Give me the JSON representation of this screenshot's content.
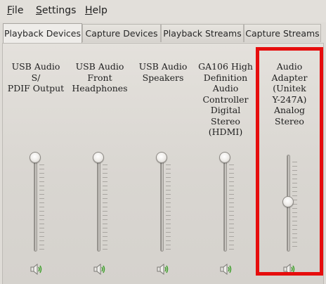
{
  "menu": {
    "items": [
      {
        "label": "File",
        "mnemonic": "F",
        "rest": "ile"
      },
      {
        "label": "Settings",
        "mnemonic": "S",
        "rest": "ettings"
      },
      {
        "label": "Help",
        "mnemonic": "H",
        "rest": "elp"
      }
    ]
  },
  "tabs": [
    {
      "label": "Playback Devices",
      "active": true
    },
    {
      "label": "Capture Devices",
      "active": false
    },
    {
      "label": "Playback Streams",
      "active": false
    },
    {
      "label": "Capture Streams",
      "active": false
    }
  ],
  "devices": [
    {
      "name": "USB Audio S/ PDIF Output",
      "lines": [
        "USB Audio S/",
        "PDIF Output"
      ],
      "volume_fraction": 1.0
    },
    {
      "name": "USB Audio Front Headphones",
      "lines": [
        "USB Audio",
        "Front",
        "Headphones"
      ],
      "volume_fraction": 1.0
    },
    {
      "name": "USB Audio Speakers",
      "lines": [
        "USB Audio",
        "Speakers"
      ],
      "volume_fraction": 1.0
    },
    {
      "name": "GA106 High Definition Audio Controller Digital Stereo (HDMI)",
      "lines": [
        "GA106 High",
        "Definition",
        "Audio",
        "Controller",
        "Digital Stereo",
        "(HDMI)"
      ],
      "volume_fraction": 1.0
    },
    {
      "name": "Audio Adapter (Unitek Y-247A) Analog Stereo",
      "lines": [
        "Audio Adapter",
        "(Unitek",
        "Y-247A)",
        "Analog Stereo"
      ],
      "volume_fraction": 0.45
    }
  ],
  "icons": {
    "speaker": "speaker-volume-icon"
  },
  "colors": {
    "highlight": "#e60d0d",
    "speaker_wave": "#3fa02c"
  }
}
